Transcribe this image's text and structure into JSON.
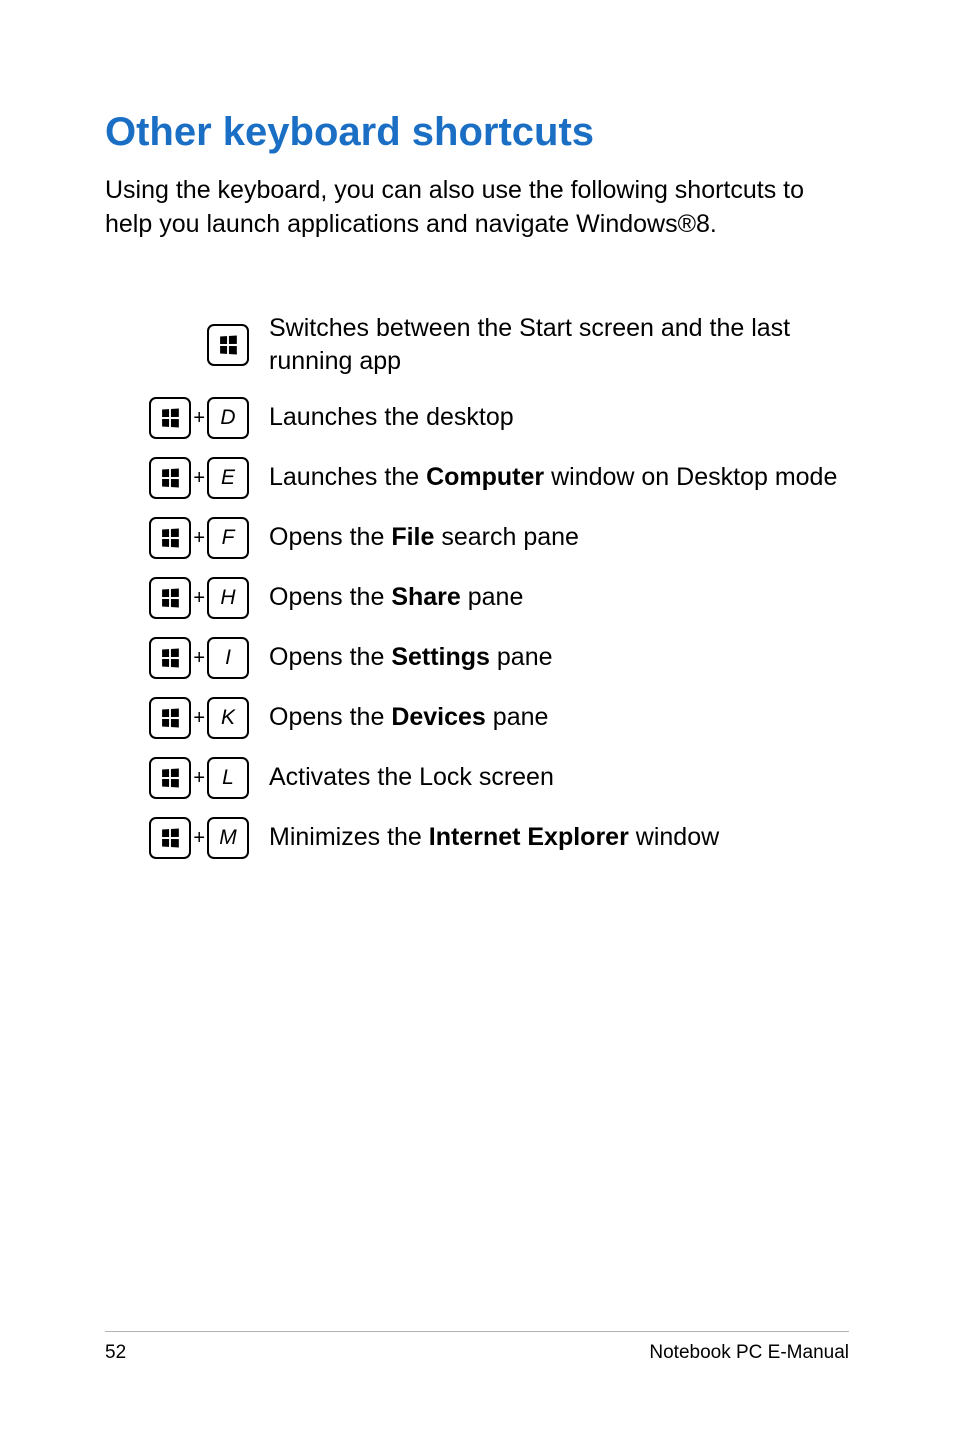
{
  "title": "Other keyboard shortcuts",
  "intro": "Using the keyboard, you can also use the following shortcuts to help you launch applications and navigate Windows®8.",
  "plus": "+",
  "shortcuts": [
    {
      "combo": [
        "win"
      ],
      "parts": [
        {
          "t": "Switches between the Start screen and the last running app"
        }
      ]
    },
    {
      "combo": [
        "win",
        "D"
      ],
      "parts": [
        {
          "t": "Launches the desktop"
        }
      ]
    },
    {
      "combo": [
        "win",
        "E"
      ],
      "parts": [
        {
          "t": "Launches the "
        },
        {
          "t": "Computer",
          "b": true
        },
        {
          "t": " window on Desktop mode"
        }
      ]
    },
    {
      "combo": [
        "win",
        "F"
      ],
      "parts": [
        {
          "t": "Opens the "
        },
        {
          "t": "File",
          "b": true
        },
        {
          "t": " search pane"
        }
      ]
    },
    {
      "combo": [
        "win",
        "H"
      ],
      "parts": [
        {
          "t": "Opens the "
        },
        {
          "t": "Share",
          "b": true
        },
        {
          "t": " pane"
        }
      ]
    },
    {
      "combo": [
        "win",
        "I"
      ],
      "parts": [
        {
          "t": "Opens the "
        },
        {
          "t": "Settings",
          "b": true
        },
        {
          "t": " pane"
        }
      ]
    },
    {
      "combo": [
        "win",
        "K"
      ],
      "parts": [
        {
          "t": "Opens the "
        },
        {
          "t": "Devices",
          "b": true
        },
        {
          "t": " pane"
        }
      ]
    },
    {
      "combo": [
        "win",
        "L"
      ],
      "parts": [
        {
          "t": "Activates the Lock screen"
        }
      ]
    },
    {
      "combo": [
        "win",
        "M"
      ],
      "parts": [
        {
          "t": "Minimizes the "
        },
        {
          "t": "Internet Explorer",
          "b": true
        },
        {
          "t": " window"
        }
      ]
    }
  ],
  "footer": {
    "page": "52",
    "label": "Notebook PC E-Manual"
  }
}
